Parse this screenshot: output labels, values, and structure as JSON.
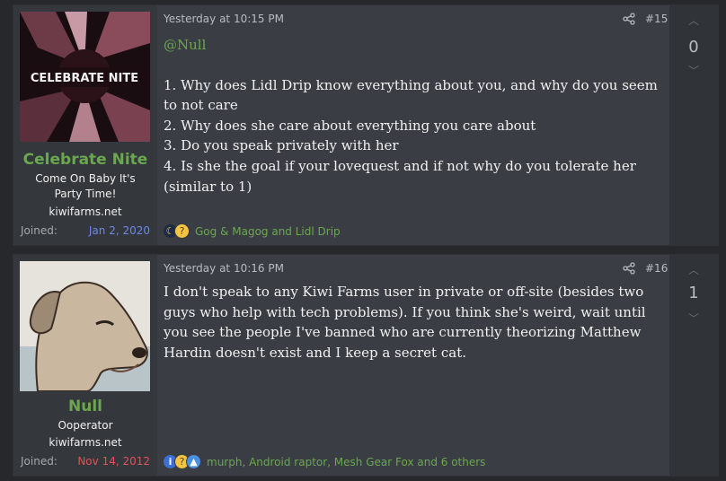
{
  "posts": [
    {
      "user": {
        "name": "Celebrate Nite",
        "title": "Come On Baby It's Party Time!",
        "site": "kiwifarms.net",
        "joined_label": "Joined:",
        "joined_date": "Jan 2, 2020",
        "avatar_text": "CELEBRATE NITE"
      },
      "time": "Yesterday at 10:15 PM",
      "number": "#15",
      "mention": "@Null",
      "lines": [
        "1. Why does Lidl Drip know everything about you, and why do you seem to not care",
        "2. Why does she care about everything you care about",
        "3. Do you speak privately with her",
        "4. Is she the goal if your lovequest and if not why do you tolerate her (similar to 1)"
      ],
      "reactions": {
        "icons": [
          "moon-icon",
          "thinking-icon"
        ],
        "names": "Gog & Magog and Lidl Drip"
      },
      "score": "0"
    },
    {
      "user": {
        "name": "Null",
        "title": "Ooperator",
        "site": "kiwifarms.net",
        "joined_label": "Joined:",
        "joined_date": "Nov 14, 2012"
      },
      "time": "Yesterday at 10:16 PM",
      "number": "#16",
      "body": "I don't speak to any Kiwi Farms user in private or off-site (besides two guys who help with tech problems). If you think she's weird, wait until you see the people I've banned who are currently theorizing Matthew Hardin doesn't exist and I keep a secret cat.",
      "reactions": {
        "icons": [
          "info-icon",
          "thinking-icon",
          "thumbs-up-icon"
        ],
        "names": "murph, Android raptor, Mesh Gear Fox and 6 others"
      },
      "score": "1"
    }
  ],
  "colors": {
    "username": "#6aa84f",
    "joined_blue": "#6f87e8",
    "joined_red": "#e0535a",
    "background": "#26282c",
    "post_bg": "#3a3d43"
  }
}
